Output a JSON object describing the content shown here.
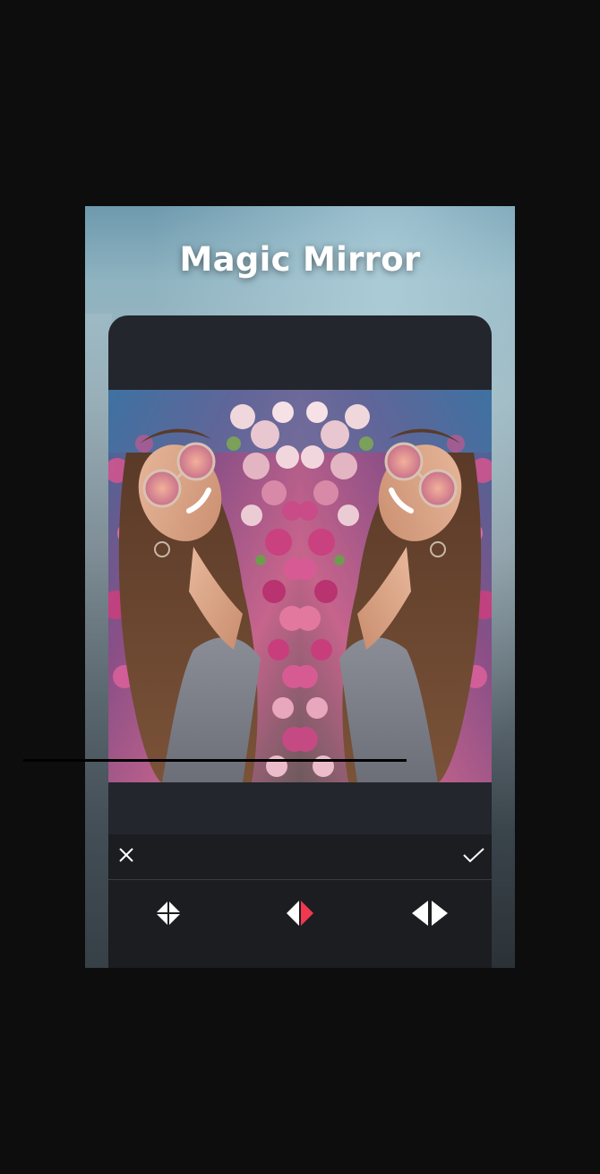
{
  "app": {
    "title": "Magic Mirror"
  },
  "editor": {
    "photo_description_icon": "mirrored-photo",
    "cancel_icon": "close-icon",
    "confirm_icon": "check-icon"
  },
  "mirror_modes": [
    {
      "icon": "quad-mirror-icon",
      "selected": false
    },
    {
      "icon": "left-right-mirror-icon",
      "selected": true
    },
    {
      "icon": "horizontal-flip-icon",
      "selected": false
    }
  ],
  "colors": {
    "accent": "#f0394f",
    "toolbar_bg": "#1b1d21",
    "panel_bg": "#23262d",
    "page_bg": "#0d0d0d"
  }
}
